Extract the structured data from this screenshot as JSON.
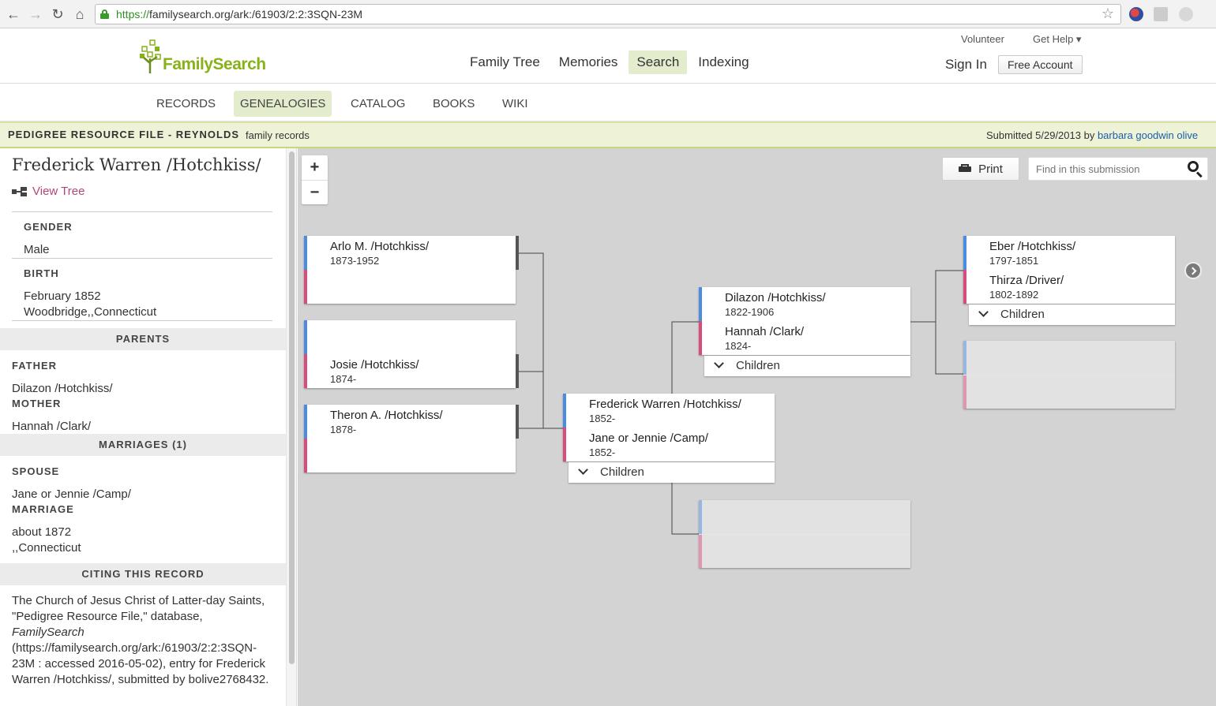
{
  "browser": {
    "url_scheme": "https://",
    "url_rest": "familysearch.org/ark:/61903/2:2:3SQN-23M"
  },
  "header": {
    "logo_text": "FamilySearch",
    "nav": [
      "Family Tree",
      "Memories",
      "Search",
      "Indexing"
    ],
    "active_nav": "Search",
    "volunteer": "Volunteer",
    "get_help": "Get Help ▾",
    "sign_in": "Sign In",
    "free_account": "Free Account"
  },
  "subnav": {
    "tabs": [
      "RECORDS",
      "GENEALOGIES",
      "CATALOG",
      "BOOKS",
      "WIKI"
    ],
    "active": "GENEALOGIES"
  },
  "resource_bar": {
    "title": "PEDIGREE RESOURCE FILE - REYNOLDS",
    "subtitle": "family records",
    "submitted_prefix": "Submitted 5/29/2013 by ",
    "submitter": "barbara goodwin olive"
  },
  "person": {
    "name": "Frederick Warren /Hotchkiss/",
    "view_tree": "View Tree",
    "gender_label": "GENDER",
    "gender": "Male",
    "birth_label": "BIRTH",
    "birth_date": "February 1852",
    "birth_place": "Woodbridge,,Connecticut",
    "parents_header": "PARENTS",
    "father_label": "FATHER",
    "father": "Dilazon /Hotchkiss/",
    "mother_label": "MOTHER",
    "mother": "Hannah /Clark/",
    "marriages_header": "MARRIAGES (1)",
    "spouse_label": "SPOUSE",
    "spouse": "Jane or Jennie /Camp/",
    "marriage_label": "MARRIAGE",
    "marriage_date": "about 1872",
    "marriage_place": ",,Connecticut",
    "citing_header": "CITING THIS RECORD",
    "citation_part1": "The Church of Jesus Christ of Latter-day Saints, \"Pedigree Resource File,\" database, ",
    "citation_italic": "FamilySearch",
    "citation_part2": " (https://familysearch.org/ark:/61903/2:2:3SQN-23M : accessed 2016-05-02), entry for Frederick Warren /Hotchkiss/, submitted by bolive2768432."
  },
  "tree": {
    "zoom_in": "+",
    "zoom_out": "−",
    "print": "Print",
    "find_placeholder": "Find in this submission",
    "children_label": "Children",
    "children_cards": [
      {
        "name": "Arlo M. /Hotchkiss/",
        "dates": "1873-1952"
      },
      {
        "name": "Josie /Hotchkiss/",
        "dates": "1874-"
      },
      {
        "name": "Theron A. /Hotchkiss/",
        "dates": "1878-"
      }
    ],
    "focus_couple": {
      "husband": "Frederick Warren /Hotchkiss/",
      "husband_dates": "1852-",
      "wife": "Jane or Jennie /Camp/",
      "wife_dates": "1852-"
    },
    "parents_couple": {
      "husband": "Dilazon /Hotchkiss/",
      "husband_dates": "1822-1906",
      "wife": "Hannah /Clark/",
      "wife_dates": "1824-"
    },
    "grandparents_couple": {
      "husband": "Eber /Hotchkiss/",
      "husband_dates": "1797-1851",
      "wife": "Thirza /Driver/",
      "wife_dates": "1802-1892"
    }
  },
  "colors": {
    "brand_green": "#87b21a",
    "male_bar": "#4b8ce2",
    "female_bar": "#d94b7b",
    "active_tab_bg": "#e3eccc",
    "link_pink": "#b2457a"
  }
}
